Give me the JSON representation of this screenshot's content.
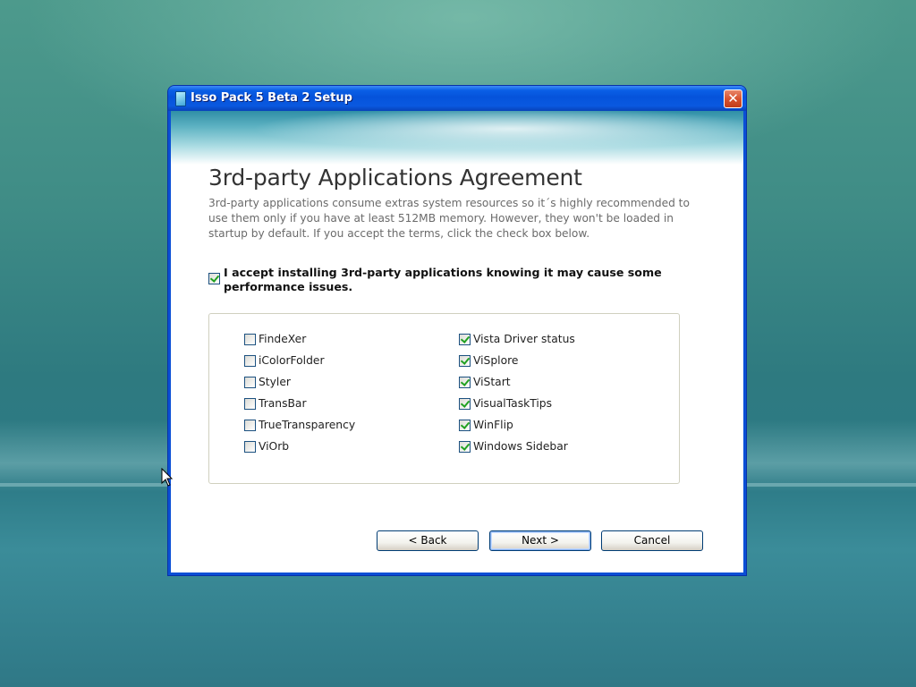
{
  "window": {
    "title": "Isso Pack 5 Beta 2 Setup",
    "close_glyph": "✕"
  },
  "page": {
    "heading": "3rd-party Applications Agreement",
    "description": "3rd-party applications consume extras system resources so it´s highly recommended to use them only if you have at least 512MB memory. However, they won't be loaded in startup by default. If you accept the terms, click the check box below."
  },
  "accept": {
    "label": "I accept installing 3rd-party applications knowing it may cause some performance issues.",
    "checked": true
  },
  "apps": {
    "left": [
      {
        "label": "FindeXer",
        "checked": false
      },
      {
        "label": "iColorFolder",
        "checked": false
      },
      {
        "label": "Styler",
        "checked": false
      },
      {
        "label": "TransBar",
        "checked": false
      },
      {
        "label": "TrueTransparency",
        "checked": false
      },
      {
        "label": "ViOrb",
        "checked": false
      }
    ],
    "right": [
      {
        "label": "Vista Driver status",
        "checked": true
      },
      {
        "label": "ViSplore",
        "checked": true
      },
      {
        "label": "ViStart",
        "checked": true
      },
      {
        "label": "VisualTaskTips",
        "checked": true
      },
      {
        "label": "WinFlip",
        "checked": true
      },
      {
        "label": "Windows Sidebar",
        "checked": true
      }
    ]
  },
  "buttons": {
    "back": "< Back",
    "next": "Next >",
    "cancel": "Cancel"
  },
  "icons": {
    "app": "setup-app-icon",
    "close": "close-icon",
    "cursor": "mouse-pointer-icon"
  },
  "colors": {
    "titlebar": "#0553db",
    "check": "#21a121",
    "close": "#d8522f"
  }
}
